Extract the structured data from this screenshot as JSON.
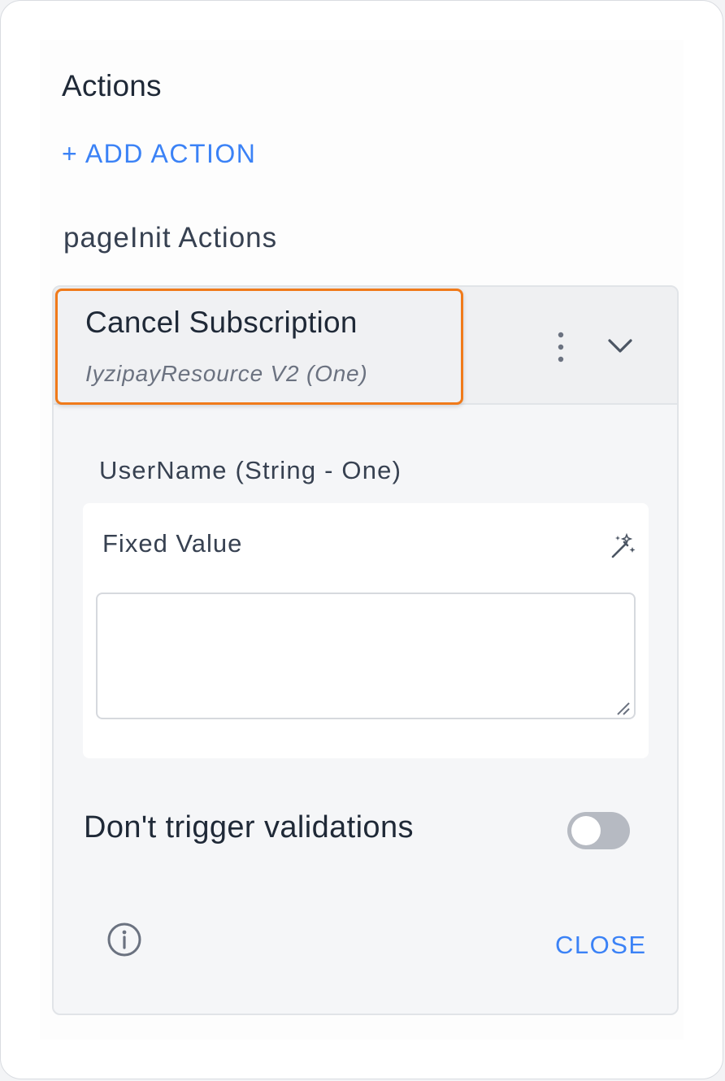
{
  "panel": {
    "section_title": "Actions",
    "add_action_label": "+ ADD ACTION",
    "group_title": "pageInit Actions"
  },
  "action": {
    "name": "Cancel Subscription",
    "resource": "IyzipayResource V2 (One)",
    "more_icon": "more-vertical-icon",
    "expand_icon": "chevron-down-icon"
  },
  "parameter": {
    "label": "UserName (String - One)",
    "mode_label": "Fixed Value",
    "mode_icon": "magic-wand-icon",
    "value": "",
    "placeholder": ""
  },
  "options": {
    "dont_trigger_validations_label": "Don't trigger validations",
    "dont_trigger_validations": false
  },
  "footer": {
    "info_icon": "info-icon",
    "close_label": "CLOSE"
  },
  "colors": {
    "accent": "#3b82f6",
    "highlight": "#f07a1a",
    "toggle_off": "#b6bac2"
  }
}
